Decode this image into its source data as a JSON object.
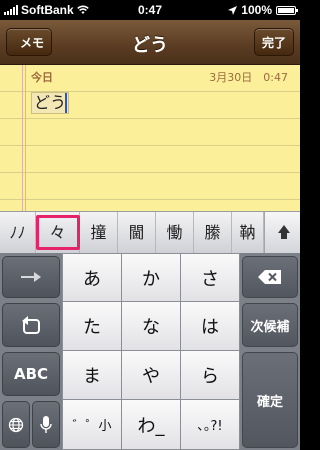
{
  "status": {
    "carrier": "SoftBank",
    "time": "0:47",
    "battery": "100%",
    "signal_bars": 5,
    "battery_level": 1.0
  },
  "nav": {
    "title": "どう",
    "back_label": "メモ",
    "done_label": "完了"
  },
  "note": {
    "date": "今日",
    "timestamp": "3月30日　0:47",
    "text": "どう"
  },
  "candidates": {
    "items": [
      "ﾉﾉ",
      "々",
      "撞",
      "閫",
      "慟",
      "縢",
      "靹"
    ],
    "selected": "々"
  },
  "keyboard": {
    "rows": [
      [
        "あ",
        "か",
        "さ"
      ],
      [
        "た",
        "な",
        "は"
      ],
      [
        "ま",
        "や",
        "ら"
      ],
      [
        "゛゜小",
        "わ_",
        "､｡?!"
      ]
    ],
    "left_keys": {
      "abc_label": "ABC"
    },
    "right_keys": {
      "next_candidate_label": "次候補",
      "confirm_label": "確定"
    }
  },
  "colors": {
    "nav_brown": "#5a3c22",
    "paper_yellow": "#fbef9a",
    "highlight_pink": "#e5226a",
    "keyboard_gray": "#7c8189"
  }
}
